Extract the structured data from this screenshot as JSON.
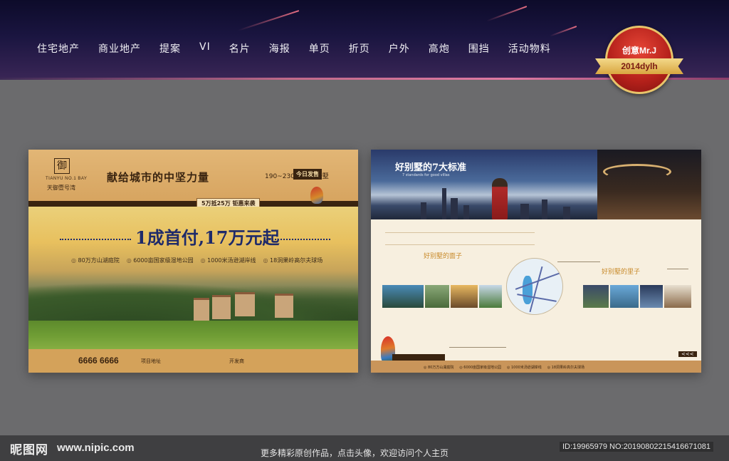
{
  "nav": {
    "items": [
      "住宅地产",
      "商业地产",
      "提案",
      "VI",
      "名片",
      "海报",
      "单页",
      "折页",
      "户外",
      "高炮",
      "围挡",
      "活动物料"
    ]
  },
  "badge": {
    "title": "创意Mr.J",
    "ribbon": "2014dylh",
    "colors": {
      "circle": "#c0261e",
      "ribbon": "#e8bf60"
    }
  },
  "left_card": {
    "logo_char": "御",
    "logo_en": "TIANYU NO.1 BAY",
    "logo_cn": "天御壹号湾",
    "headline": "献给城市的中坚力量",
    "area": "190~230㎡ 山湖一墅",
    "tag": "今日发售",
    "promo": "5万抵25万  钜惠来袭",
    "main_offer": "1成首付,17万元起",
    "features": [
      "80万方山湖庭院",
      "6000亩国家级湿地公园",
      "1000米汤逊湖岸线",
      "18洞果岭高尔夫球场"
    ],
    "phone": "6666 6666",
    "footer_labels": [
      "项目地址",
      "开发商"
    ]
  },
  "right_card": {
    "title": "好别墅的7大标准",
    "subtitle": "7 standards for good villas",
    "heading_yard": "好别墅的面子",
    "heading_inner": "好别墅的里子",
    "footer_items": [
      "80万方山湖庭院",
      "6000亩国家级湿地公园",
      "1000米汤逊湖岸线",
      "18洞果岭高尔夫球场"
    ],
    "arrows": "<<<"
  },
  "watermark": {
    "logo": "昵图网",
    "url": "www.nipic.com",
    "center": "更多精彩原创作品，点击头像，欢迎访问个人主页",
    "id": "ID:19965979 NO:20190802215416671081"
  }
}
